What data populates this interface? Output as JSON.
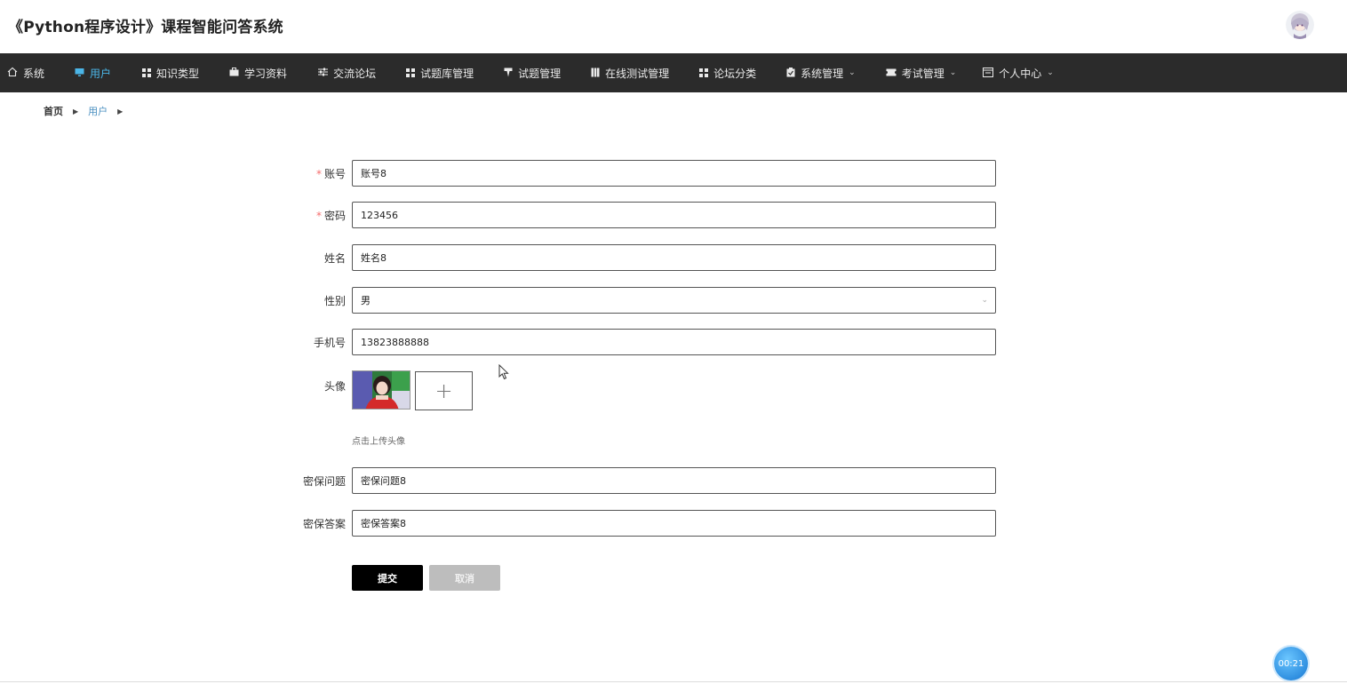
{
  "header": {
    "title": "《Python程序设计》课程智能问答系统"
  },
  "nav": {
    "items": [
      {
        "label": "系统",
        "icon": "home-icon"
      },
      {
        "label": "用户",
        "icon": "monitor-icon"
      },
      {
        "label": "知识类型",
        "icon": "grid-icon"
      },
      {
        "label": "学习资料",
        "icon": "briefcase-icon"
      },
      {
        "label": "交流论坛",
        "icon": "sliders-icon"
      },
      {
        "label": "试题库管理",
        "icon": "grid-icon"
      },
      {
        "label": "试题管理",
        "icon": "filter-icon"
      },
      {
        "label": "在线测试管理",
        "icon": "columns-icon"
      },
      {
        "label": "论坛分类",
        "icon": "grid-icon"
      },
      {
        "label": "系统管理",
        "icon": "clipboard-icon"
      },
      {
        "label": "考试管理",
        "icon": "ticket-icon"
      },
      {
        "label": "个人中心",
        "icon": "window-icon"
      }
    ],
    "active": "用户"
  },
  "breadcrumb": {
    "home": "首页",
    "current": "用户"
  },
  "form": {
    "account": {
      "label": "账号",
      "value": "账号8",
      "required": true
    },
    "password": {
      "label": "密码",
      "value": "123456",
      "required": true
    },
    "name": {
      "label": "姓名",
      "value": "姓名8"
    },
    "gender": {
      "label": "性别",
      "value": "男"
    },
    "phone": {
      "label": "手机号",
      "value": "13823888888"
    },
    "avatar": {
      "label": "头像",
      "upload_tip": "点击上传头像"
    },
    "security_question": {
      "label": "密保问题",
      "value": "密保问题8"
    },
    "security_answer": {
      "label": "密保答案",
      "value": "密保答案8"
    },
    "submit_label": "提交",
    "cancel_label": "取消"
  },
  "timer": "00:21",
  "colors": {
    "nav_bg": "#2b2b2b",
    "nav_active": "#4bb6e8",
    "submit_bg": "#000000",
    "cancel_bg": "#bdbdbd",
    "required": "#f56c6c"
  }
}
